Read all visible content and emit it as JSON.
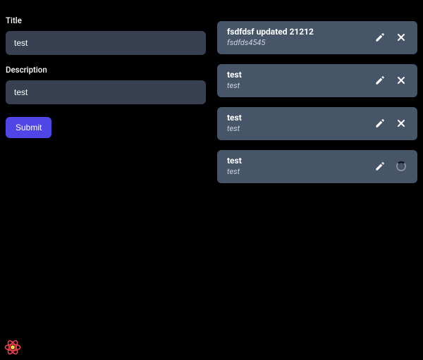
{
  "form": {
    "title_label": "Title",
    "title_value": "test",
    "description_label": "Description",
    "description_value": "test",
    "submit_label": "Submit"
  },
  "items": [
    {
      "title": "fsdfdsf updated 21212",
      "description": "fsdfds4545",
      "state": "idle"
    },
    {
      "title": "test",
      "description": "test",
      "state": "idle"
    },
    {
      "title": "test",
      "description": "test",
      "state": "idle"
    },
    {
      "title": "test",
      "description": "test",
      "state": "loading"
    }
  ],
  "icons": {
    "edit": "pencil-icon",
    "delete": "close-icon",
    "loading": "spinner-icon",
    "rq": "react-query-icon"
  },
  "colors": {
    "card_bg": "#475569",
    "input_bg": "#374151",
    "accent": "#4f46e5",
    "rq_pink": "#ff4154",
    "rq_yellow": "#ffd94c"
  }
}
